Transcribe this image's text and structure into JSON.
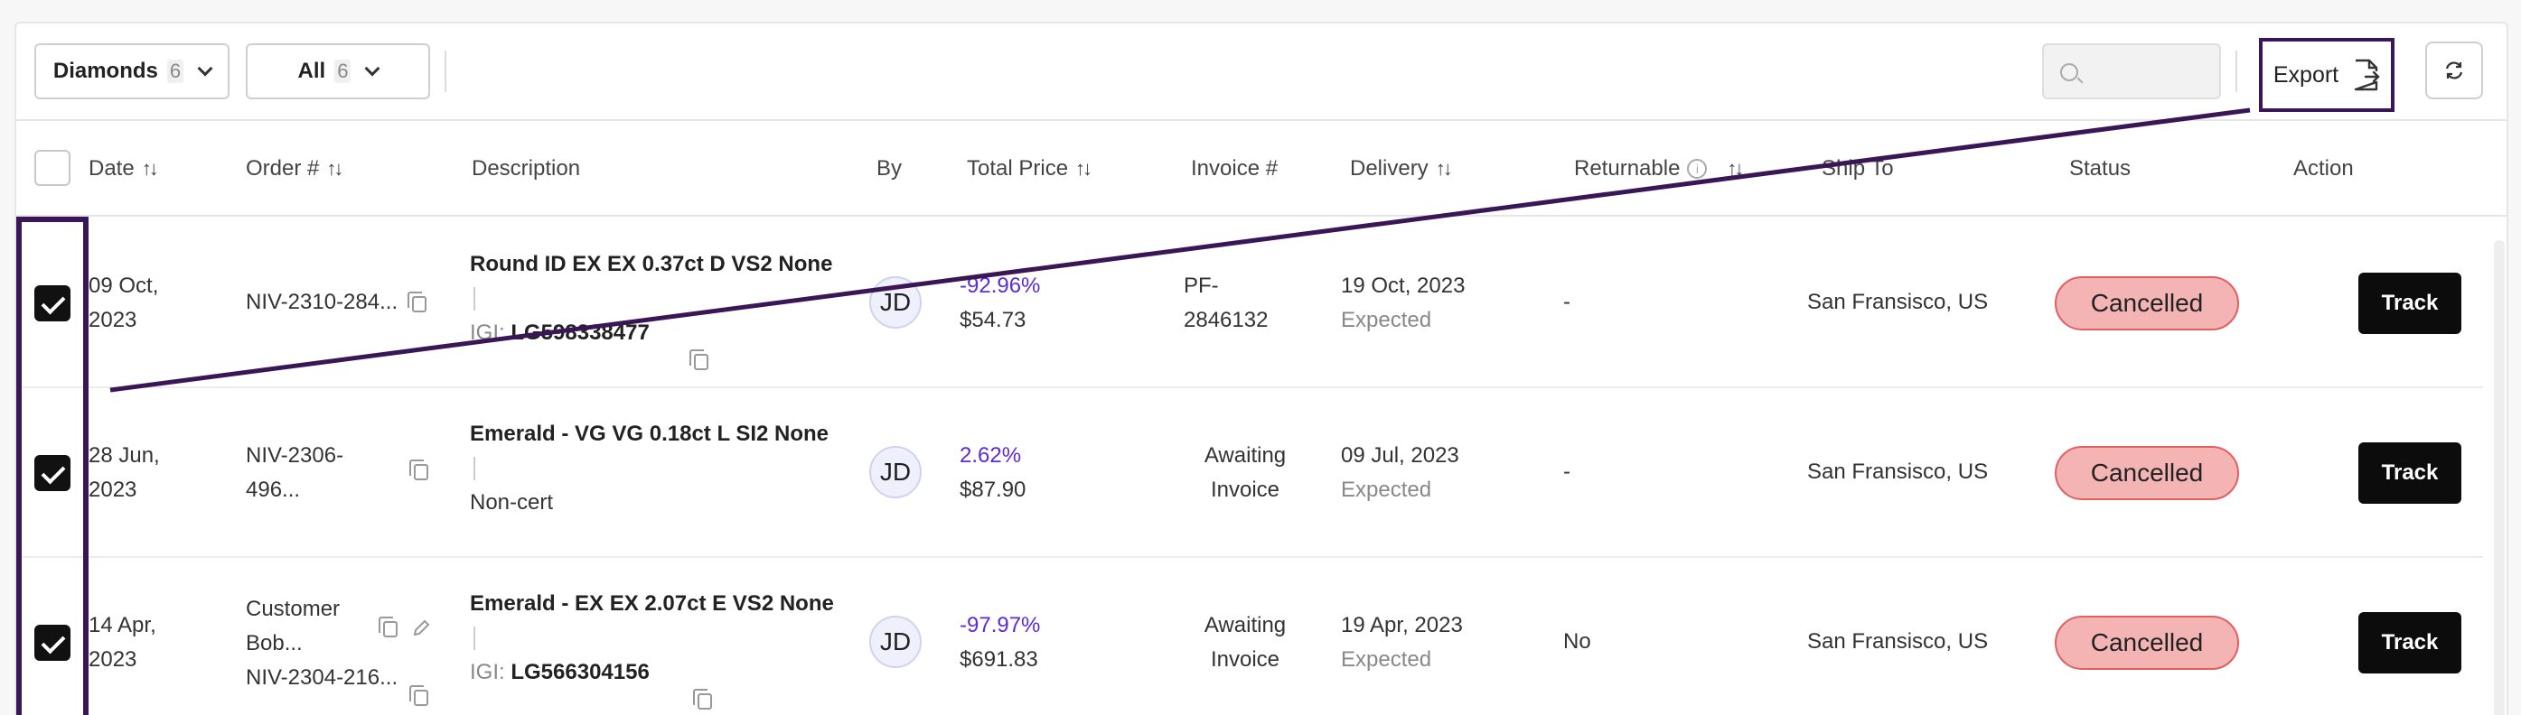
{
  "toolbar": {
    "product_filter": {
      "label": "Diamonds",
      "count": "6"
    },
    "status_filter": {
      "label": "All",
      "count": "6"
    },
    "search": {
      "placeholder": ""
    },
    "export_label": "Export"
  },
  "table": {
    "columns": [
      "Date",
      "Order #",
      "Description",
      "By",
      "Total Price",
      "Invoice #",
      "Delivery",
      "Returnable",
      "Ship To",
      "Status",
      "Action"
    ],
    "rows": [
      {
        "date_line1": "09 Oct,",
        "date_line2": "2023",
        "order_line1": "NIV-2310-284...",
        "order_line2": "",
        "order_line3": "",
        "desc_title": "Round ID EX EX 0.37ct D VS2 None",
        "desc_cert_label": "IGI:",
        "desc_cert": "LG598338477",
        "desc_note": "",
        "by": "JD",
        "pct": "-92.96%",
        "price": "$54.73",
        "invoice_line1": "PF-",
        "invoice_line2": "2846132",
        "delivery_date": "19 Oct, 2023",
        "delivery_status": "Expected",
        "returnable": "-",
        "ship_to": "San Fransisco, US",
        "status": "Cancelled",
        "action": "Track",
        "checked": true
      },
      {
        "date_line1": "28 Jun,",
        "date_line2": "2023",
        "order_line1": "NIV-2306-",
        "order_line2": "496...",
        "order_line3": "",
        "desc_title": "Emerald - VG VG 0.18ct L SI2 None",
        "desc_cert_label": "",
        "desc_cert": "",
        "desc_note": "Non-cert",
        "by": "JD",
        "pct": "2.62%",
        "price": "$87.90",
        "invoice_line1": "Awaiting",
        "invoice_line2": "Invoice",
        "delivery_date": "09 Jul, 2023",
        "delivery_status": "Expected",
        "returnable": "-",
        "ship_to": "San Fransisco, US",
        "status": "Cancelled",
        "action": "Track",
        "checked": true
      },
      {
        "date_line1": "14 Apr,",
        "date_line2": "2023",
        "order_line1": "Customer",
        "order_line2": "Bob...",
        "order_line3": "NIV-2304-216...",
        "desc_title": "Emerald - EX EX 2.07ct E VS2 None",
        "desc_cert_label": "IGI:",
        "desc_cert": "LG566304156",
        "desc_note": "",
        "by": "JD",
        "pct": "-97.97%",
        "price": "$691.83",
        "invoice_line1": "Awaiting",
        "invoice_line2": "Invoice",
        "delivery_date": "19 Apr, 2023",
        "delivery_status": "Expected",
        "returnable": "No",
        "ship_to": "San Fransisco, US",
        "status": "Cancelled",
        "action": "Track",
        "checked": true
      }
    ]
  },
  "colors": {
    "accent_purple": "#5b2bd9",
    "annotation": "#3b1657",
    "status_cancelled_bg": "#f4b4b4",
    "status_cancelled_border": "#e06060",
    "track_button": "#0c0c0c"
  },
  "icons": [
    "chevron-down-icon",
    "search-icon",
    "file-export-icon",
    "refresh-icon",
    "sort-icon",
    "info-icon",
    "copy-icon",
    "edit-icon",
    "checkmark-icon"
  ]
}
